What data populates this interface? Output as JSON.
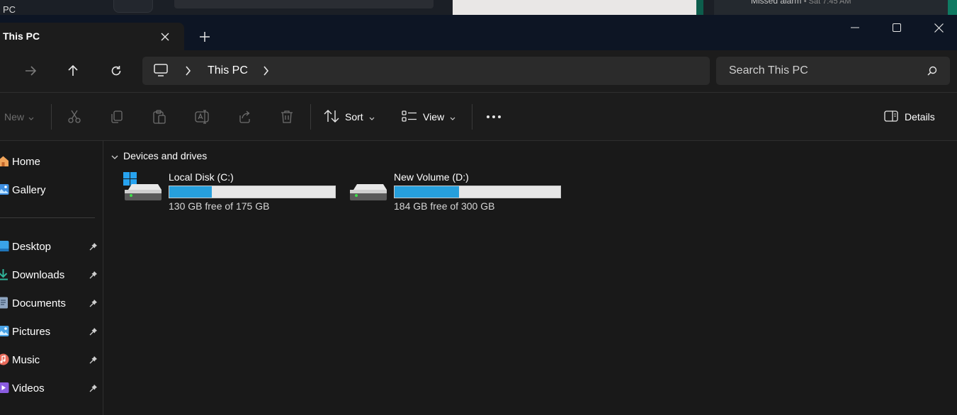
{
  "background": {
    "left_label": "PC",
    "notification_text": "Missed alarm",
    "notification_time": "• Sat 7:45 AM"
  },
  "tab": {
    "title": "This PC"
  },
  "window": {
    "icons": [
      "minimize-icon",
      "maximize-icon",
      "close-icon"
    ]
  },
  "navigation": {
    "breadcrumb": "This PC",
    "search_placeholder": "Search This PC"
  },
  "command_bar": {
    "new_label": "New",
    "sort_label": "Sort",
    "view_label": "View",
    "details_label": "Details"
  },
  "sidebar": {
    "items": [
      {
        "label": "Home",
        "icon": "home-icon",
        "pinned": false
      },
      {
        "label": "Gallery",
        "icon": "gallery-icon",
        "pinned": false
      },
      {
        "label": "Desktop",
        "icon": "desktop-icon",
        "pinned": true
      },
      {
        "label": "Downloads",
        "icon": "downloads-icon",
        "pinned": true
      },
      {
        "label": "Documents",
        "icon": "documents-icon",
        "pinned": true
      },
      {
        "label": "Pictures",
        "icon": "pictures-icon",
        "pinned": true
      },
      {
        "label": "Music",
        "icon": "music-icon",
        "pinned": true
      },
      {
        "label": "Videos",
        "icon": "videos-icon",
        "pinned": true
      }
    ]
  },
  "content": {
    "group_label": "Devices and drives",
    "drives": [
      {
        "name": "Local Disk (C:)",
        "free_text": "130 GB free of 175 GB",
        "used_fraction": 0.257,
        "windows_logo": true
      },
      {
        "name": "New Volume (D:)",
        "free_text": "184 GB free of 300 GB",
        "used_fraction": 0.387,
        "windows_logo": false
      }
    ]
  },
  "colors": {
    "accent": "#269fdc",
    "titlebar": "#0d1524",
    "surface": "#1c1c1c",
    "background": "#191919"
  }
}
